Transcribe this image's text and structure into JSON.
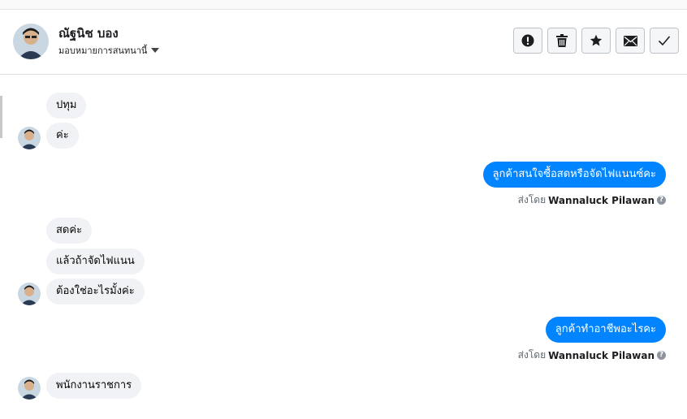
{
  "header": {
    "contact_name": "ณัฐนิช บอง",
    "assign_label": "มอบหมายการสนทนานี้"
  },
  "actions": [
    {
      "icon": "exclamation-icon"
    },
    {
      "icon": "trash-icon"
    },
    {
      "icon": "star-icon"
    },
    {
      "icon": "envelope-icon"
    },
    {
      "icon": "check-icon"
    }
  ],
  "conversation": {
    "sent_by_prefix": "ส่งโดย",
    "agent_name": "Wannaluck Pilawan",
    "messages": [
      {
        "from": "customer",
        "text": "ปทุม"
      },
      {
        "from": "customer",
        "text": "ค่ะ"
      },
      {
        "from": "page",
        "text": "ลูกค้าสนใจซื้อสดหรือจัดไฟแนนซ์คะ"
      },
      {
        "from": "customer",
        "text": "สดค่ะ"
      },
      {
        "from": "customer",
        "text": "แล้วถ้าจัดไฟแนน"
      },
      {
        "from": "customer",
        "text": "ต้องใช่อะไรมั้งค่ะ"
      },
      {
        "from": "page",
        "text": "ลูกค้าทำอาชีพอะไรคะ"
      },
      {
        "from": "customer",
        "text": "พนักงานราชการ"
      }
    ]
  }
}
